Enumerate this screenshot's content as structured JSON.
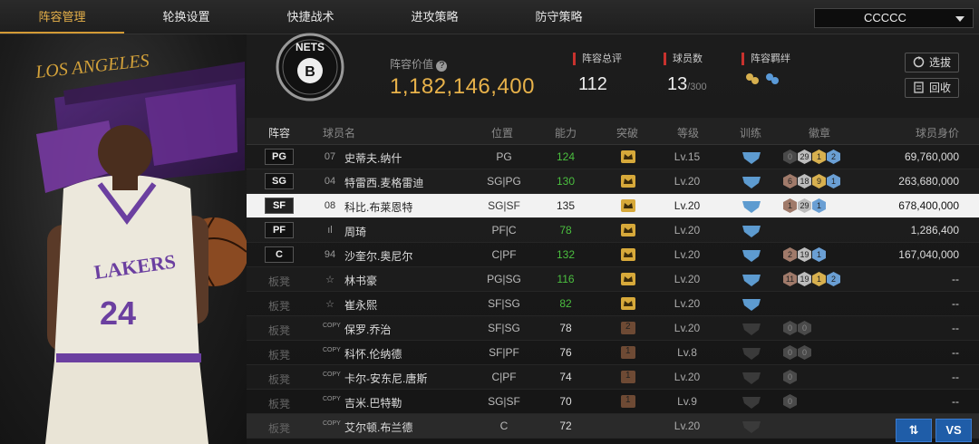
{
  "nav": {
    "tabs": [
      "阵容管理",
      "轮换设置",
      "快捷战术",
      "进攻策略",
      "防守策略"
    ],
    "team_select": "CCCCC"
  },
  "header": {
    "value_label": "阵容价值",
    "value": "1,182,146,400",
    "rating_label": "阵容总评",
    "rating": "112",
    "count_label": "球员数",
    "count": "13",
    "count_max": "/300",
    "bond_label": "阵容羁绊",
    "btn_select": "选拔",
    "btn_recycle": "回收"
  },
  "table": {
    "headers": {
      "lineup": "阵容",
      "name": "球员名",
      "position": "位置",
      "ability": "能力",
      "breakthrough": "突破",
      "level": "等级",
      "training": "训练",
      "badges": "徽章",
      "price": "球员身价"
    },
    "rows": [
      {
        "slot": "PG",
        "num": "07",
        "name": "史蒂夫.纳什",
        "pos": "PG",
        "ability": "124",
        "green": true,
        "level": "Lv.15",
        "badges": [
          [
            "b-dark",
            "0"
          ],
          [
            "b-silver",
            "29"
          ],
          [
            "b-gold",
            "1"
          ],
          [
            "b-blue",
            "2"
          ]
        ],
        "price": "69,760,000"
      },
      {
        "slot": "SG",
        "num": "04",
        "name": "特雷西.麦格雷迪",
        "pos": "SG|PG",
        "ability": "130",
        "green": true,
        "level": "Lv.20",
        "badges": [
          [
            "b-bronze",
            "6"
          ],
          [
            "b-silver",
            "18"
          ],
          [
            "b-gold",
            "9"
          ],
          [
            "b-blue",
            "1"
          ]
        ],
        "price": "263,680,000"
      },
      {
        "slot": "SF",
        "num": "08",
        "name": "科比.布莱恩特",
        "pos": "SG|SF",
        "ability": "135",
        "green": false,
        "level": "Lv.20",
        "badges": [
          [
            "b-bronze",
            "1"
          ],
          [
            "b-silver",
            "29"
          ],
          [
            "b-blue",
            "1"
          ]
        ],
        "price": "678,400,000"
      },
      {
        "slot": "PF",
        "num": "ıl",
        "name": "周琦",
        "pos": "PF|C",
        "ability": "78",
        "green": true,
        "level": "Lv.20",
        "badges": [],
        "price": "1,286,400"
      },
      {
        "slot": "C",
        "num": "94",
        "name": "沙奎尔.奥尼尔",
        "pos": "C|PF",
        "ability": "132",
        "green": true,
        "level": "Lv.20",
        "badges": [
          [
            "b-bronze",
            "2"
          ],
          [
            "b-silver",
            "19"
          ],
          [
            "b-blue",
            "1"
          ]
        ],
        "price": "167,040,000"
      },
      {
        "slot": "板凳",
        "num": "☆",
        "name": "林书豪",
        "pos": "PG|SG",
        "ability": "116",
        "green": true,
        "level": "Lv.20",
        "badges": [
          [
            "b-bronze",
            "11"
          ],
          [
            "b-silver",
            "19"
          ],
          [
            "b-gold",
            "1"
          ],
          [
            "b-blue",
            "2"
          ]
        ],
        "price": "--"
      },
      {
        "slot": "板凳",
        "num": "☆",
        "name": "崔永熙",
        "pos": "SF|SG",
        "ability": "82",
        "green": true,
        "level": "Lv.20",
        "badges": [],
        "price": "--"
      },
      {
        "slot": "板凳",
        "num": "COPY",
        "name": "保罗.乔治",
        "pos": "SF|SG",
        "ability": "78",
        "green": false,
        "level": "Lv.20",
        "brk": "2",
        "badges": [
          [
            "b-dark",
            "0"
          ],
          [
            "b-dark",
            "0"
          ]
        ],
        "price": "--"
      },
      {
        "slot": "板凳",
        "num": "COPY",
        "name": "科怀.伦纳德",
        "pos": "SF|PF",
        "ability": "76",
        "green": false,
        "level": "Lv.8",
        "brk": "1",
        "badges": [
          [
            "b-dark",
            "0"
          ],
          [
            "b-dark",
            "0"
          ]
        ],
        "price": "--"
      },
      {
        "slot": "板凳",
        "num": "COPY",
        "name": "卡尔-安东尼.唐斯",
        "pos": "C|PF",
        "ability": "74",
        "green": false,
        "level": "Lv.20",
        "brk": "1",
        "badges": [
          [
            "b-dark",
            "0"
          ]
        ],
        "price": "--"
      },
      {
        "slot": "板凳",
        "num": "COPY",
        "name": "吉米.巴特勒",
        "pos": "SG|SF",
        "ability": "70",
        "green": false,
        "level": "Lv.9",
        "brk": "1",
        "badges": [
          [
            "b-dark",
            "0"
          ]
        ],
        "price": "--"
      },
      {
        "slot": "板凳",
        "num": "COPY",
        "name": "艾尔顿.布兰德",
        "pos": "C",
        "ability": "72",
        "green": false,
        "level": "Lv.20",
        "brk": "",
        "badges": [],
        "price": ""
      }
    ]
  },
  "bottom": {
    "swap": "⇅",
    "vs": "VS"
  },
  "colors": {
    "accent": "#e8b24a",
    "green": "#4bbf3f",
    "red_marker": "#c8322e",
    "blue_btn": "#1f5da8"
  }
}
